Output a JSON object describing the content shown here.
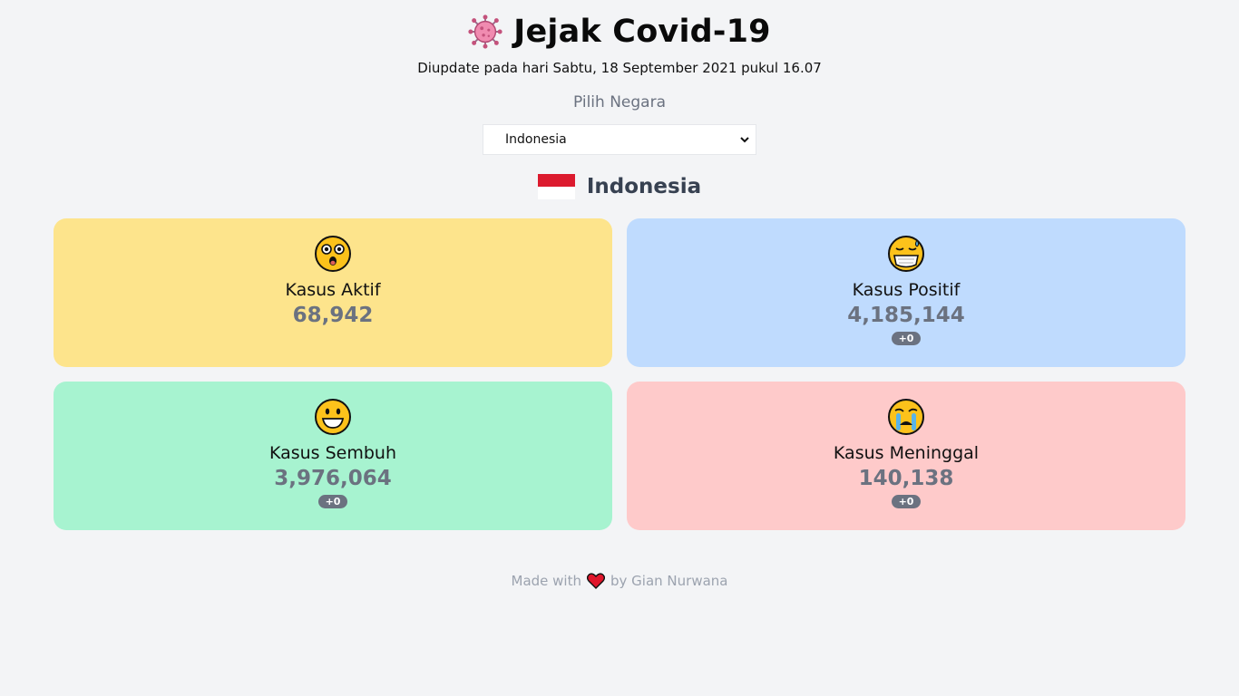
{
  "header": {
    "title": "Jejak Covid-19",
    "icon": "virus-icon"
  },
  "updated_text": "Diupdate pada hari Sabtu, 18 September 2021 pukul 16.07",
  "select": {
    "label": "Pilih Negara",
    "value": "Indonesia"
  },
  "country": {
    "name": "Indonesia",
    "flag_colors": [
      "#dc1a2e",
      "#ffffff"
    ]
  },
  "cards": [
    {
      "label": "Kasus Aktif",
      "value": "68,942",
      "emoji": "astonished-face-icon",
      "color": "#fde48c"
    },
    {
      "label": "Kasus Positif",
      "value": "4,185,144",
      "delta": "+0",
      "emoji": "masked-sweat-face-icon",
      "color": "#bfdbfe"
    },
    {
      "label": "Kasus Sembuh",
      "value": "3,976,064",
      "delta": "+0",
      "emoji": "grinning-face-icon",
      "color": "#a7f3d0"
    },
    {
      "label": "Kasus Meninggal",
      "value": "140,138",
      "delta": "+0",
      "emoji": "crying-face-icon",
      "color": "#fecaca"
    }
  ],
  "footer": {
    "prefix": "Made with",
    "suffix": "by Gian Nurwana",
    "icon": "heart-icon"
  }
}
